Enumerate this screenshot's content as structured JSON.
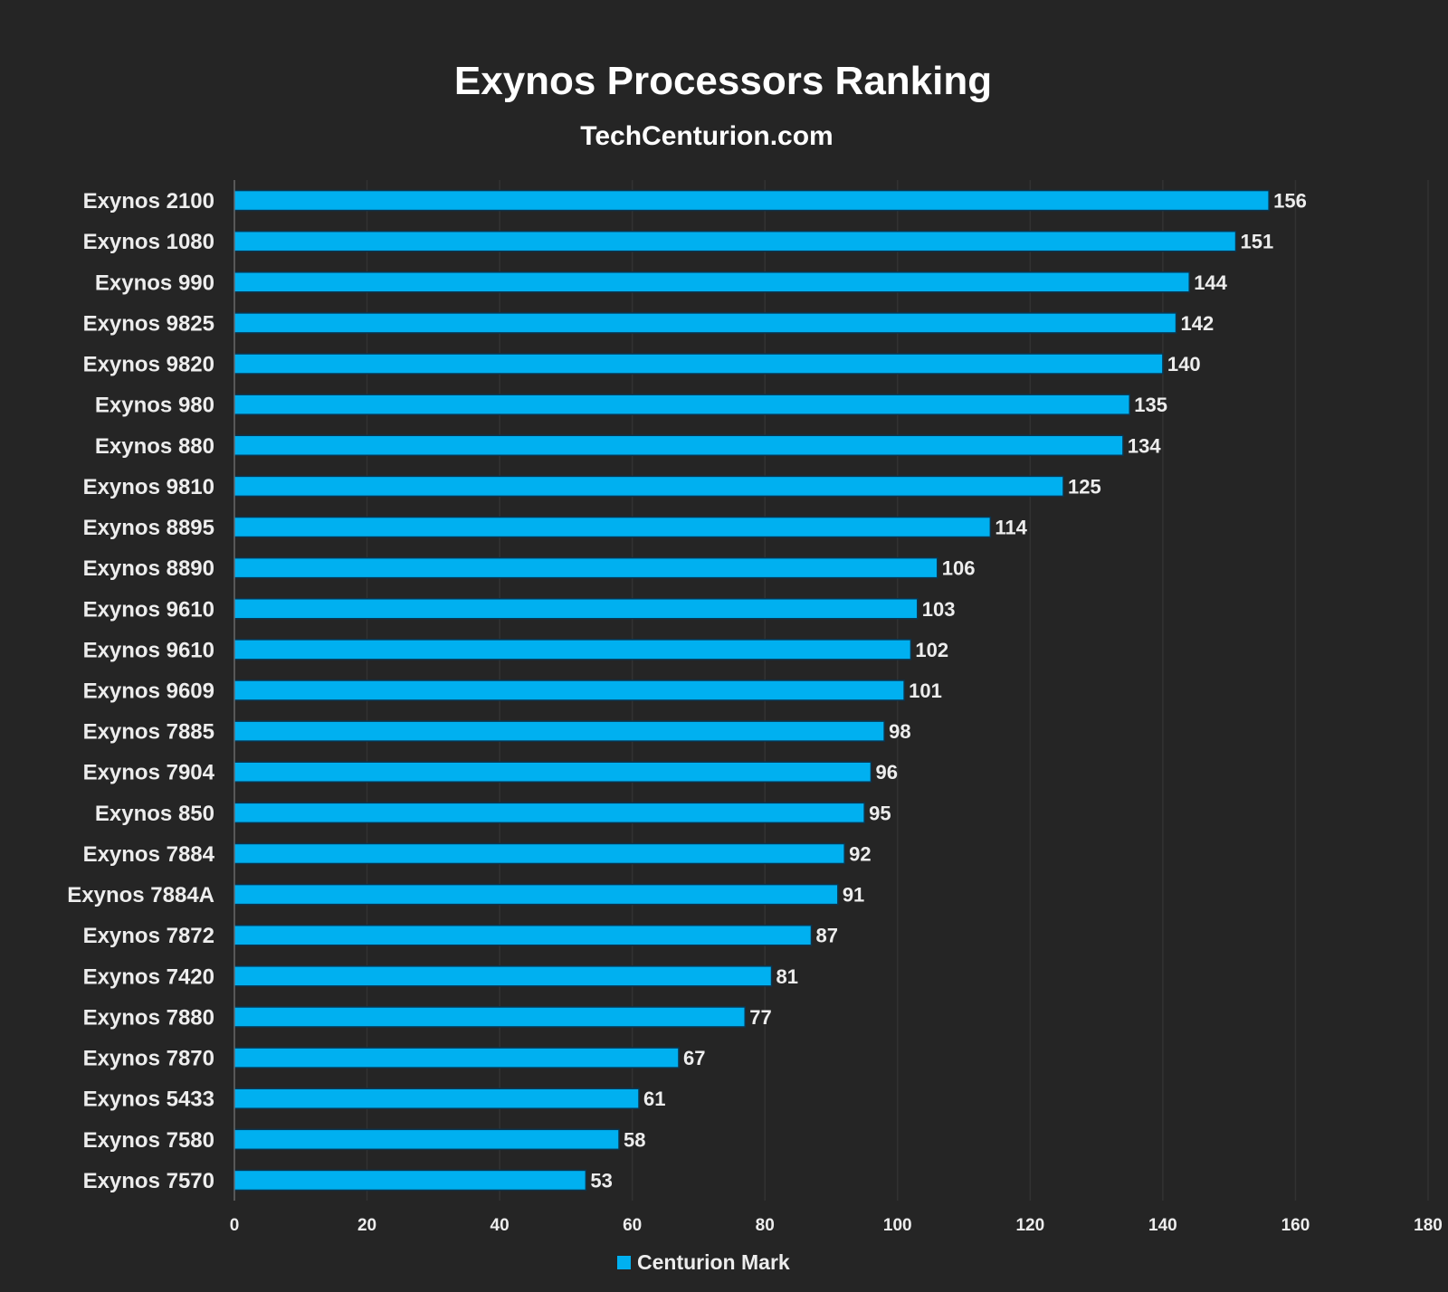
{
  "chart_data": {
    "type": "bar",
    "orientation": "horizontal",
    "title": "Exynos Processors Ranking",
    "subtitle": "TechCenturion.com",
    "xlabel": "",
    "ylabel": "",
    "xlim": [
      0,
      180
    ],
    "xticks": [
      0,
      20,
      40,
      60,
      80,
      100,
      120,
      140,
      160,
      180
    ],
    "grid": true,
    "legend": {
      "position": "bottom",
      "entries": [
        "Centurion Mark"
      ]
    },
    "bar_color": "#00b0f0",
    "categories": [
      "Exynos 2100",
      "Exynos 1080",
      "Exynos 990",
      "Exynos 9825",
      "Exynos 9820",
      "Exynos 980",
      "Exynos 880",
      "Exynos 9810",
      "Exynos 8895",
      "Exynos 8890",
      "Exynos 9610",
      "Exynos 9610",
      "Exynos 9609",
      "Exynos 7885",
      "Exynos 7904",
      "Exynos 850",
      "Exynos 7884",
      "Exynos 7884A",
      "Exynos 7872",
      "Exynos 7420",
      "Exynos 7880",
      "Exynos 7870",
      "Exynos 5433",
      "Exynos 7580",
      "Exynos 7570"
    ],
    "series": [
      {
        "name": "Centurion Mark",
        "values": [
          156,
          151,
          144,
          142,
          140,
          135,
          134,
          125,
          114,
          106,
          103,
          102,
          101,
          98,
          96,
          95,
          92,
          91,
          87,
          81,
          77,
          67,
          61,
          58,
          53
        ]
      }
    ]
  }
}
